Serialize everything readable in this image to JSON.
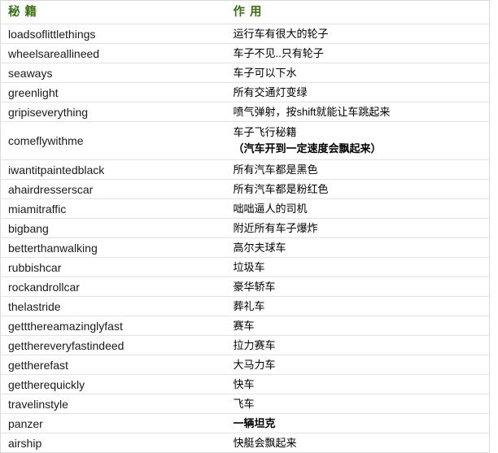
{
  "table": {
    "headers": {
      "code": "秘 籍",
      "effect": "作 用"
    },
    "rows": [
      {
        "code": "loadsoflittlethings",
        "effect": "运行车有很大的轮子"
      },
      {
        "code": "wheelsareallineed",
        "effect": "车子不见..只有轮子"
      },
      {
        "code": "seaways",
        "effect": "车子可以下水"
      },
      {
        "code": "greenlight",
        "effect": "所有交通灯变绿"
      },
      {
        "code": "gripiseverything",
        "effect": "喷气弹射，按shift就能让车跳起来"
      },
      {
        "code": "comeflywithme",
        "effect": "车子飞行秘籍",
        "effect2": "（汽车开到一定速度会飘起来）"
      },
      {
        "code": "iwantitpaintedblack",
        "effect": "所有汽车都是黑色"
      },
      {
        "code": "ahairdresserscar",
        "effect": "所有汽车都是粉红色"
      },
      {
        "code": "miamitraffic",
        "effect": "咄咄逼人的司机"
      },
      {
        "code": "bigbang",
        "effect": "附近所有车子爆炸"
      },
      {
        "code": "betterthanwalking",
        "effect": "高尔夫球车"
      },
      {
        "code": "rubbishcar",
        "effect": "垃圾车"
      },
      {
        "code": "rockandrollcar",
        "effect": "豪华轿车"
      },
      {
        "code": "thelastride",
        "effect": "葬礼车"
      },
      {
        "code": "gettthereamazinglyfast",
        "effect": "赛车"
      },
      {
        "code": "getthereveryfastindeed",
        "effect": "拉力赛车"
      },
      {
        "code": "gettherefast",
        "effect": "大马力车"
      },
      {
        "code": "gettherequickly",
        "effect": "快车"
      },
      {
        "code": "travelinstyle",
        "effect": "飞车"
      },
      {
        "code": "panzer",
        "effect": "一辆坦克",
        "bold": true
      },
      {
        "code": "airship",
        "effect": "快艇会飘起来"
      }
    ]
  },
  "colors": {
    "header_text": "#3a7010",
    "border": "#e2e2e2",
    "outer_border": "#d9d9d9",
    "body_text": "#000000"
  }
}
